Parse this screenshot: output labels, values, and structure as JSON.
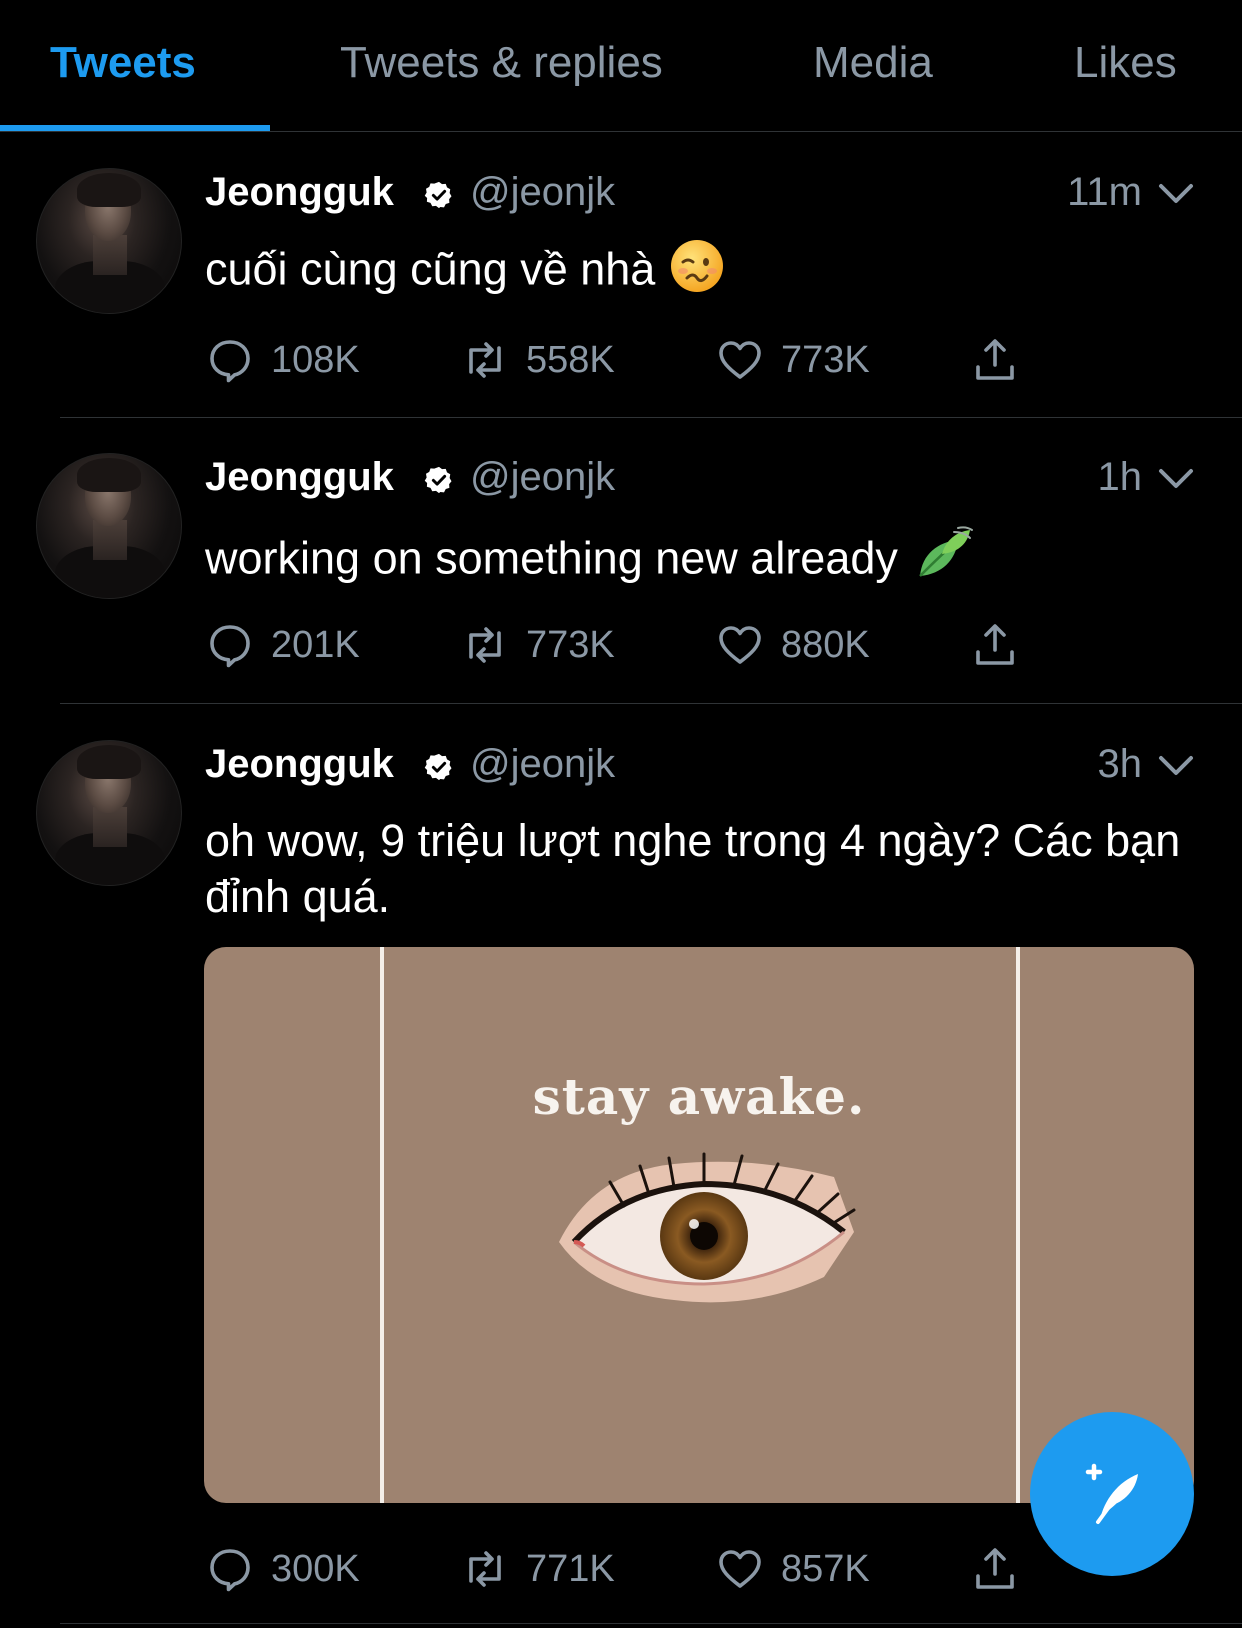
{
  "tabs": [
    {
      "label": "Tweets",
      "active": true
    },
    {
      "label": "Tweets & replies",
      "active": false
    },
    {
      "label": "Media",
      "active": false
    },
    {
      "label": "Likes",
      "active": false
    }
  ],
  "colors": {
    "accent": "#1d9bf0",
    "background": "#000000",
    "muted": "#8b98a5"
  },
  "tweets": [
    {
      "name": "Jeongguk",
      "handle": "@jeonjk",
      "time": "11m",
      "text": "cuối cùng cũng về nhà",
      "emoji": "woozy-face",
      "replies": "108K",
      "retweets": "558K",
      "likes": "773K"
    },
    {
      "name": "Jeongguk",
      "handle": "@jeonjk",
      "time": "1h",
      "text": "working on something new already",
      "emoji": "leaf-fluttering-in-wind",
      "replies": "201K",
      "retweets": "773K",
      "likes": "880K"
    },
    {
      "name": "Jeongguk",
      "handle": "@jeonjk",
      "time": "3h",
      "text": "oh wow, 9 triệu lượt nghe trong 4 ngày? Các bạn đỉnh quá.",
      "media_caption": "stay awake.",
      "replies": "300K",
      "retweets": "771K",
      "likes": "857K"
    }
  ],
  "icons": {
    "reply": "comment-icon",
    "retweet": "retweet-icon",
    "like": "heart-icon",
    "share": "share-icon",
    "verified": "verified-badge-icon",
    "compose": "compose-tweet-icon"
  }
}
